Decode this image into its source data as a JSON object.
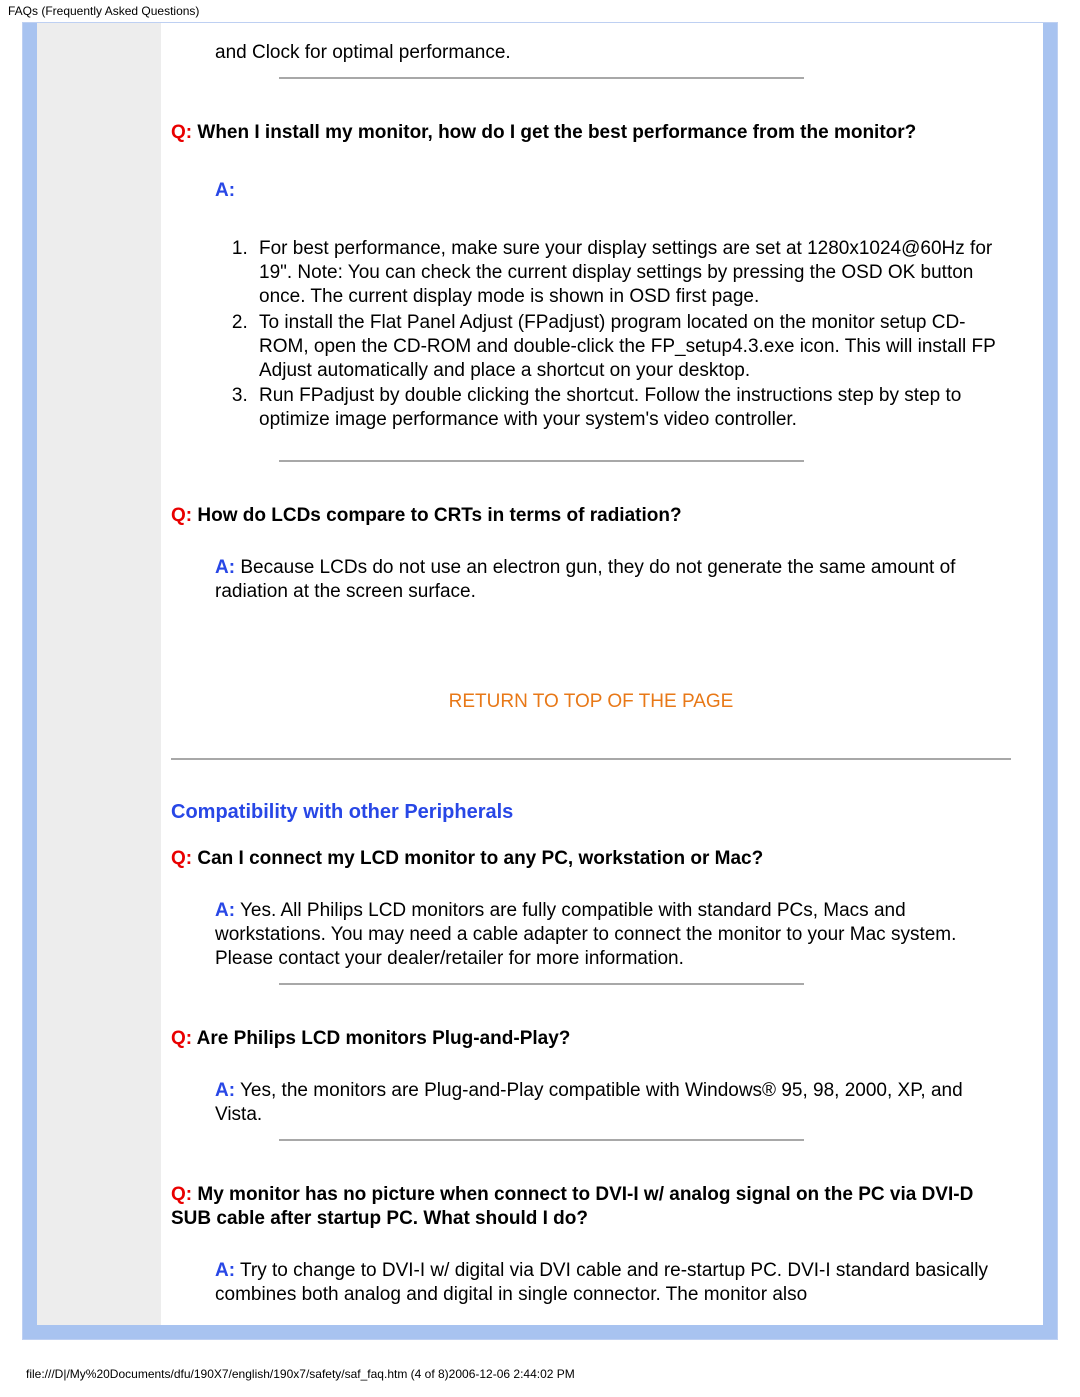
{
  "page_header": "FAQs (Frequently Asked Questions)",
  "precut_text": "and Clock for optimal performance.",
  "q_prefix": "Q:",
  "a_prefix": "A:",
  "faq1": {
    "q": " When I install my monitor, how do I get the best performance from the monitor?",
    "list": [
      "For best performance, make sure your display settings are set at 1280x1024@60Hz for 19\". Note: You can check the current display settings by pressing the OSD OK button once. The current display mode is shown in OSD first page.",
      "To install the Flat Panel Adjust (FPadjust) program located on the monitor setup CD-ROM, open the CD-ROM and double-click the FP_setup4.3.exe icon. This will install FP Adjust automatically and place a shortcut on your desktop.",
      "Run FPadjust by double clicking the shortcut. Follow the instructions step by step to optimize image performance with your system's video controller."
    ]
  },
  "faq2": {
    "q": " How do LCDs compare to CRTs in terms of radiation?",
    "a": " Because LCDs do not use an electron gun, they do not generate the same amount of radiation at the screen surface."
  },
  "return_link": "RETURN TO TOP OF THE PAGE",
  "section_title": "Compatibility with other Peripherals",
  "faq3": {
    "q": " Can I connect my LCD monitor to any PC, workstation or Mac?",
    "a": " Yes. All Philips LCD monitors are fully compatible with standard PCs, Macs and workstations. You may need a cable adapter to connect the monitor to your Mac system. Please contact your dealer/retailer for more information."
  },
  "faq4": {
    "q": " Are Philips LCD monitors Plug-and-Play?",
    "a": " Yes, the monitors are Plug-and-Play compatible with Windows® 95, 98, 2000, XP, and Vista."
  },
  "faq5": {
    "q": " My monitor has no picture when connect to DVI-I w/ analog signal on the PC via DVI-D SUB cable after startup PC. What should I do?",
    "a": " Try to change to DVI-I w/ digital via DVI cable and re-startup PC. DVI-I standard basically combines both analog and digital in single connector. The monitor also"
  },
  "footer": "file:///D|/My%20Documents/dfu/190X7/english/190x7/safety/saf_faq.htm (4 of 8)2006-12-06 2:44:02 PM"
}
